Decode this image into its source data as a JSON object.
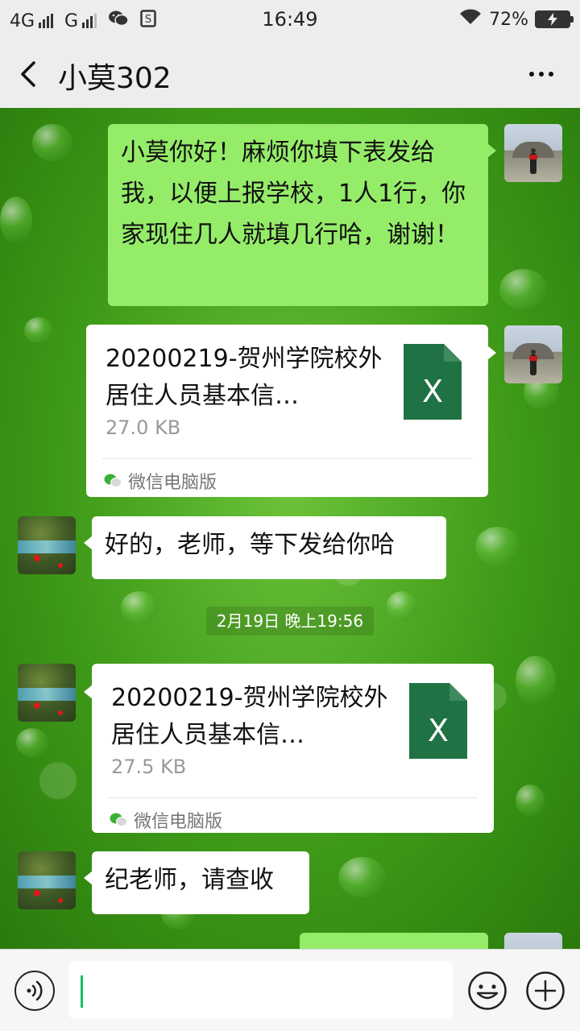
{
  "status_bar": {
    "network_1": "4G",
    "network_2": "G",
    "time": "16:49",
    "battery_percent": "72%",
    "icons": [
      "signal-icon",
      "wechat-icon",
      "sim-icon",
      "wifi-icon",
      "battery-charging-icon"
    ]
  },
  "header": {
    "title": "小莫302",
    "back_icon": "chevron-left-icon",
    "more_icon": "more-dots-icon"
  },
  "messages": [
    {
      "sender": "me",
      "type": "text",
      "text": "小莫你好！麻烦你填下表发给我，以便上报学校，1人1行，你家现住几人就填几行哈，谢谢！"
    },
    {
      "sender": "me",
      "type": "file",
      "file_name": "20200219-贺州学院校外居住人员基本信…",
      "file_size": "27.0 KB",
      "source": "微信电脑版",
      "file_icon": "excel-file-icon"
    },
    {
      "sender": "other",
      "type": "text",
      "text": "好的，老师，等下发给你哈"
    },
    {
      "sender": "system",
      "type": "timestamp",
      "text": "2月19日 晚上19:56"
    },
    {
      "sender": "other",
      "type": "file",
      "file_name": "20200219-贺州学院校外居住人员基本信…",
      "file_size": "27.5 KB",
      "source": "微信电脑版",
      "file_icon": "excel-file-icon"
    },
    {
      "sender": "other",
      "type": "text",
      "text": "纪老师，请查收"
    }
  ],
  "input_bar": {
    "voice_icon": "voice-icon",
    "emoji_icon": "emoji-icon",
    "plus_icon": "plus-icon",
    "value": ""
  },
  "colors": {
    "my_bubble": "#95ec69",
    "other_bubble": "#ffffff",
    "excel_green": "#1f7244",
    "caret": "#07c160"
  }
}
